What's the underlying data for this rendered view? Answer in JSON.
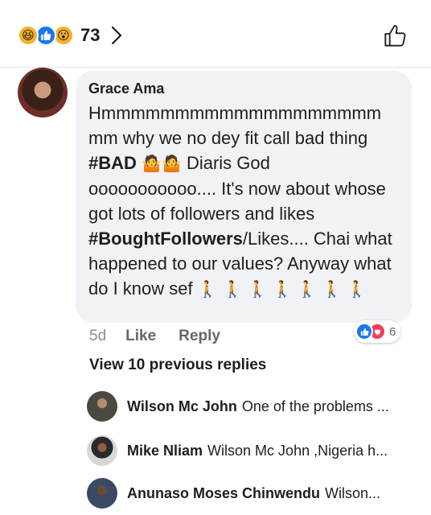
{
  "reactions": {
    "icons": [
      "haha-icon",
      "like-icon",
      "wow-icon"
    ],
    "count": "73"
  },
  "comment": {
    "author": "Grace Ama",
    "text_parts": {
      "p1": "Hmmmmmmmmmmmmmmmmmmm mm why we no dey fit call bad thing ",
      "tag1": "#BAD",
      "p2": " Diaris God ooooooooooo.... It's now about whose got lots of followers and likes ",
      "tag2": "#BoughtFollowers",
      "p3": "/Likes.... Chai what happened to our values? Anyway what do I know sef "
    },
    "time": "5d",
    "like_label": "Like",
    "reply_label": "Reply",
    "reaction_count": "6"
  },
  "view_previous": "View 10 previous replies",
  "replies": [
    {
      "name": "Wilson Mc John",
      "text": "One of the problems ..."
    },
    {
      "name": "Mike Nliam",
      "text": "Wilson Mc John ,Nigeria h..."
    },
    {
      "name": "Anunaso Moses Chinwendu",
      "text": "Wilson..."
    }
  ],
  "colors": {
    "accent": "#1877f2",
    "love": "#f33e58",
    "bubble_bg": "#f0f2f5",
    "meta_gray": "#65676b"
  }
}
